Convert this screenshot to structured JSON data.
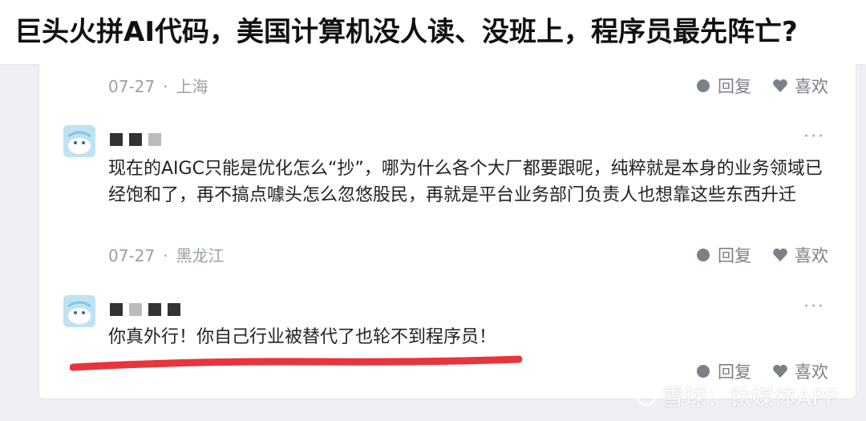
{
  "title": "巨头火拼AI代码，美国计算机没人读、没班上，程序员最先阵亡?",
  "comments": [
    {
      "date": "07-27",
      "location": "上海",
      "reply": "回复",
      "like": "喜欢"
    },
    {
      "text": "现在的AIGC只能是优化怎么“抄”，哪为什么各个大厂都要跟呢，纯粹就是本身的业务领域已经饱和了，再不搞点噱头怎么忽悠股民，再就是平台业务部门负责人也想靠这些东西升迁",
      "date": "07-27",
      "location": "黑龙江",
      "reply": "回复",
      "like": "喜欢"
    },
    {
      "text": "你真外行！你自己行业被替代了也轮不到程序员！",
      "reply": "回复",
      "like": "喜欢"
    }
  ],
  "more_label": "···",
  "meta_separator": "·",
  "watermark": "雪球：钛媒体APP",
  "colors": {
    "accent_underline": "#e8353c",
    "avatar_bg": "#bfe3f3",
    "meta": "#9aa0a8"
  }
}
